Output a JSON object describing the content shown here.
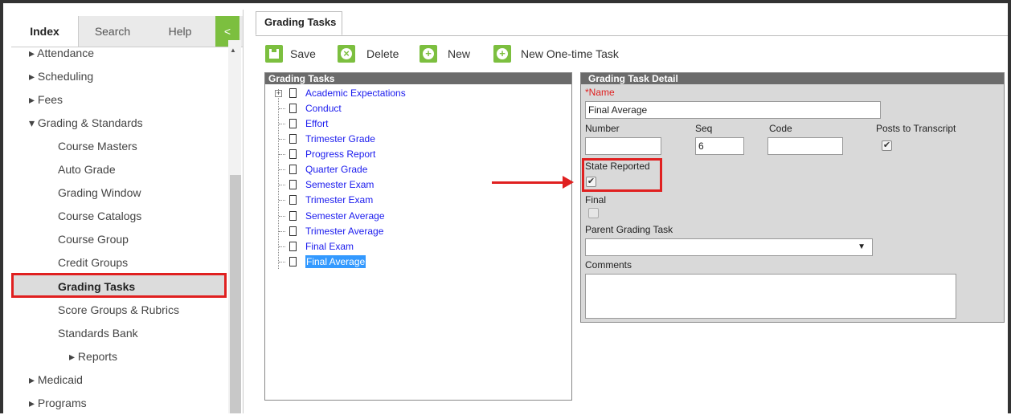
{
  "sidebar": {
    "tabs": [
      "Index",
      "Search",
      "Help"
    ],
    "collapse_glyph": "<",
    "items": [
      {
        "label": "▸ Attendance"
      },
      {
        "label": "▸ Scheduling"
      },
      {
        "label": "▸ Fees"
      },
      {
        "label": "▾ Grading & Standards"
      },
      {
        "label": "Course Masters"
      },
      {
        "label": "Auto Grade"
      },
      {
        "label": "Grading Window"
      },
      {
        "label": "Course Catalogs"
      },
      {
        "label": "Course Group"
      },
      {
        "label": "Credit Groups"
      },
      {
        "label": "Grading Tasks"
      },
      {
        "label": "Score Groups & Rubrics"
      },
      {
        "label": "Standards Bank"
      },
      {
        "label": "▸ Reports"
      },
      {
        "label": "▸ Medicaid"
      },
      {
        "label": "▸ Programs"
      }
    ]
  },
  "main": {
    "tab_title": "Grading Tasks",
    "toolbar": {
      "save": "Save",
      "delete": "Delete",
      "new": "New",
      "new_one_time": "New One-time Task"
    },
    "tasks_panel": {
      "title": "Grading Tasks",
      "items": [
        "Academic Expectations",
        "Conduct",
        "Effort",
        "Trimester Grade",
        "Progress Report",
        "Quarter Grade",
        "Semester Exam",
        "Trimester Exam",
        "Semester Average",
        "Trimester Average",
        "Final Exam",
        "Final Average"
      ],
      "selected": "Final Average"
    },
    "detail": {
      "title": "Grading Task Detail",
      "name_label": "*Name",
      "name_value": "Final Average",
      "number_label": "Number",
      "number_value": "",
      "seq_label": "Seq",
      "seq_value": "6",
      "code_label": "Code",
      "code_value": "",
      "posts_label": "Posts to Transcript",
      "posts_checked": true,
      "state_label": "State Reported",
      "state_checked": true,
      "final_label": "Final",
      "final_checked": false,
      "parent_label": "Parent Grading Task",
      "parent_value": "",
      "comments_label": "Comments",
      "comments_value": ""
    }
  },
  "colors": {
    "accent_green": "#7cbf3f",
    "highlight_red": "#e02020",
    "link_blue": "#1a1aee",
    "panel_header": "#6b6b6b"
  }
}
